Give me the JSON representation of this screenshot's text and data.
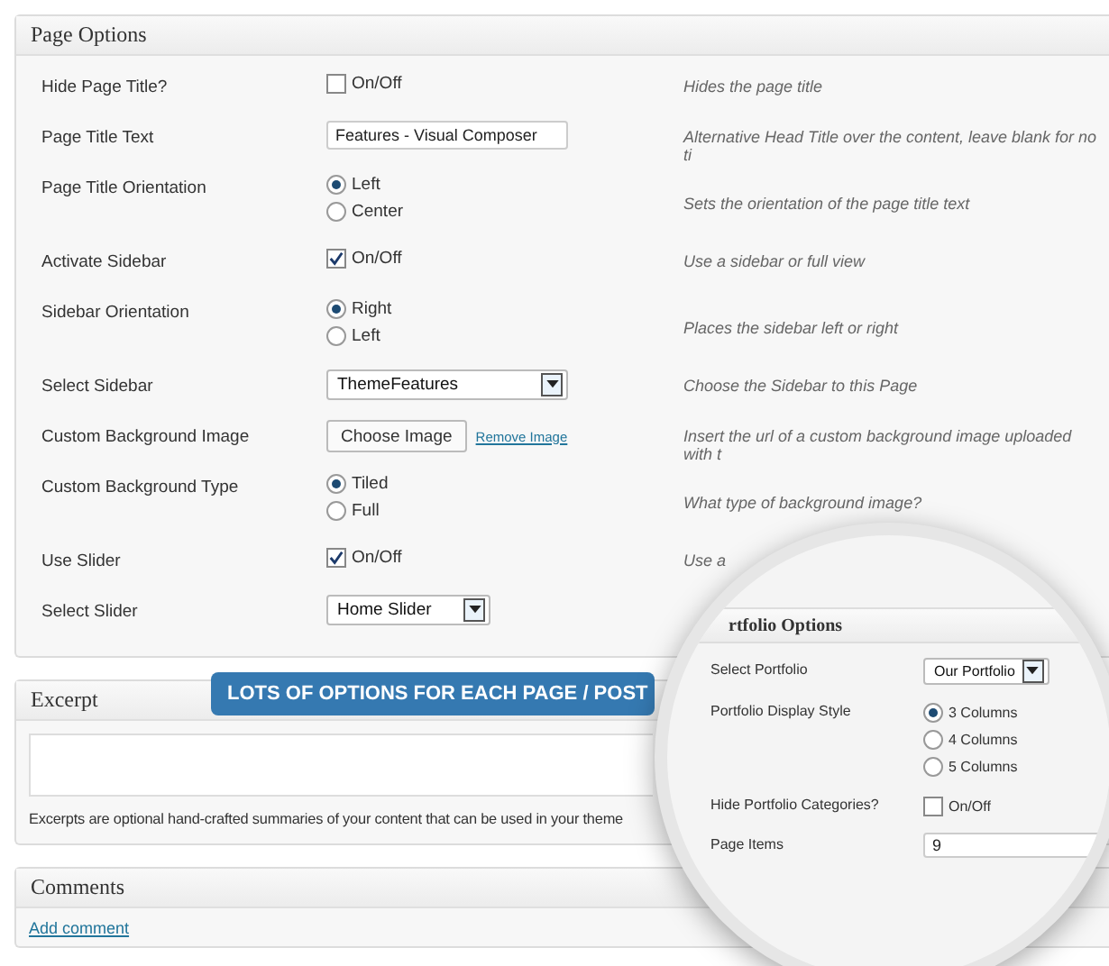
{
  "page_options": {
    "title": "Page Options",
    "rows": [
      {
        "label": "Hide Page Title?",
        "kind": "checkbox",
        "checked": false,
        "text": "On/Off",
        "description": "Hides the page title"
      },
      {
        "label": "Page Title Text",
        "kind": "text",
        "value": "Features - Visual Composer",
        "description": "Alternative Head Title over the content, leave blank for no ti"
      },
      {
        "label": "Page Title Orientation",
        "kind": "radio",
        "options": [
          {
            "label": "Left",
            "selected": true
          },
          {
            "label": "Center",
            "selected": false
          }
        ],
        "description": "Sets the orientation of the page title text"
      },
      {
        "label": "Activate Sidebar",
        "kind": "checkbox",
        "checked": true,
        "text": "On/Off",
        "description": "Use a sidebar or full view"
      },
      {
        "label": "Sidebar Orientation",
        "kind": "radio",
        "options": [
          {
            "label": "Right",
            "selected": true
          },
          {
            "label": "Left",
            "selected": false
          }
        ],
        "description": "Places the sidebar left or right"
      },
      {
        "label": "Select Sidebar",
        "kind": "select",
        "value": "ThemeFeatures",
        "description": "Choose the Sidebar to this Page"
      },
      {
        "label": "Custom Background Image",
        "kind": "image",
        "button": "Choose Image",
        "link": "Remove Image",
        "description": "Insert the url of a custom background image uploaded with t"
      },
      {
        "label": "Custom Background Type",
        "kind": "radio",
        "options": [
          {
            "label": "Tiled",
            "selected": true
          },
          {
            "label": "Full",
            "selected": false
          }
        ],
        "description": "What type of background image?"
      },
      {
        "label": "Use Slider",
        "kind": "checkbox",
        "checked": true,
        "text": "On/Off",
        "description": "Use a"
      },
      {
        "label": "Select Slider",
        "kind": "select",
        "value": "Home Slider"
      }
    ]
  },
  "excerpt": {
    "title": "Excerpt",
    "help": "Excerpts are optional hand-crafted summaries of your content that can be used in your theme"
  },
  "comments": {
    "title": "Comments",
    "link": "Add comment"
  },
  "banner": "LOTS OF OPTIONS FOR EACH PAGE / POST",
  "magnifier": {
    "title": "rtfolio Options",
    "rows": [
      {
        "label": "Select Portfolio",
        "kind": "select",
        "value": "Our Portfolio"
      },
      {
        "label": "Portfolio Display Style",
        "kind": "radio",
        "options": [
          {
            "label": "3 Columns",
            "selected": true
          },
          {
            "label": "4 Columns",
            "selected": false
          },
          {
            "label": "5 Columns",
            "selected": false
          }
        ]
      },
      {
        "label": "Hide Portfolio Categories?",
        "kind": "checkbox",
        "checked": false,
        "text": "On/Off"
      },
      {
        "label": "Page Items",
        "kind": "text",
        "value": "9"
      }
    ]
  }
}
